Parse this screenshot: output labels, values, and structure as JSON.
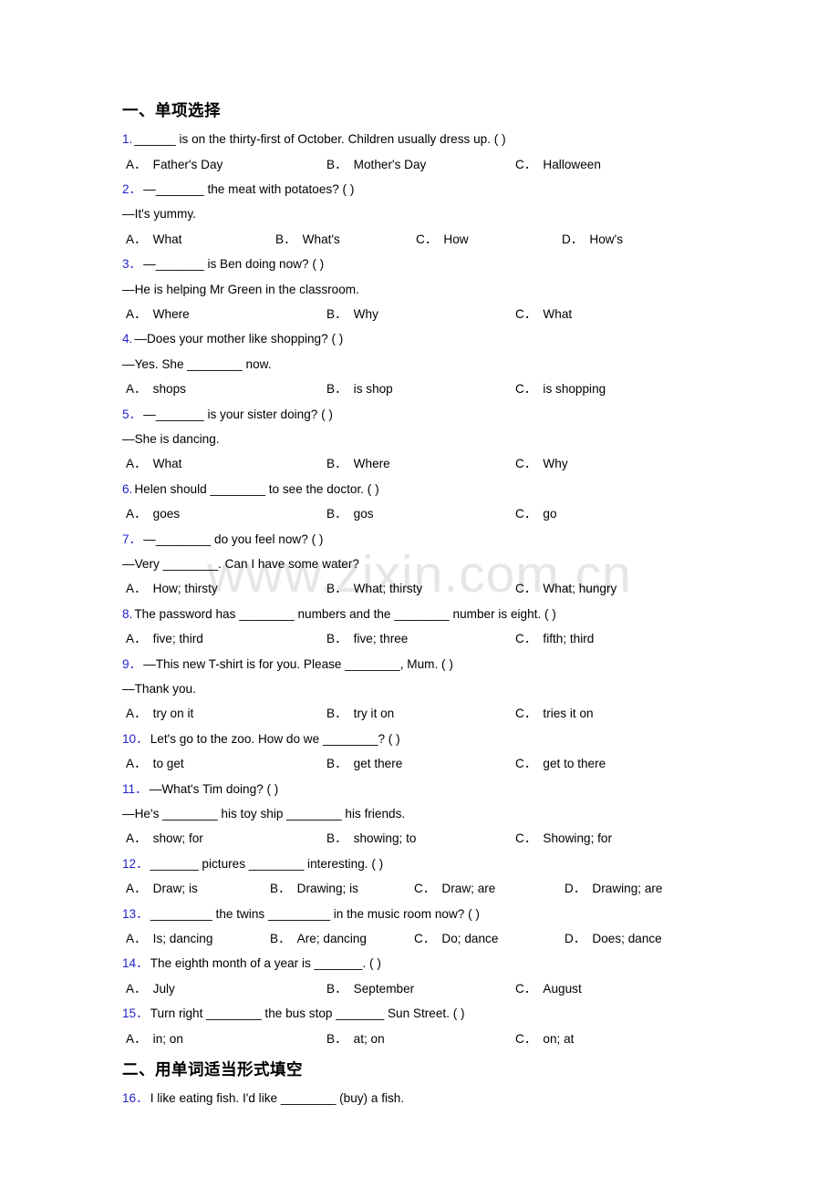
{
  "watermark": "www.zixin.com.cn",
  "colors": {
    "question_number": "#2222cc",
    "body_text": "#000000",
    "watermark": "#e6e6e6",
    "page_background": "#ffffff"
  },
  "sections": [
    {
      "id": "section-1",
      "heading": "一、单项选择"
    },
    {
      "id": "section-2",
      "heading": "二、用单词适当形式填空"
    }
  ],
  "questions": [
    {
      "num": "1.",
      "stem": "______ is on the thirty-first of October. Children usually dress up. (   )",
      "cont": null,
      "layout": "cols3",
      "options": [
        {
          "label": "A．",
          "text": "Father's Day"
        },
        {
          "label": "B．",
          "text": "Mother's Day"
        },
        {
          "label": "C．",
          "text": "Halloween"
        }
      ]
    },
    {
      "num": "2．",
      "stem": "—_______ the meat with potatoes? (   )",
      "cont": "—It's yummy.",
      "layout": "cols4",
      "options": [
        {
          "label": "A．",
          "text": "What"
        },
        {
          "label": "B．",
          "text": "What's"
        },
        {
          "label": "C．",
          "text": "How"
        },
        {
          "label": "D．",
          "text": "How's"
        }
      ]
    },
    {
      "num": "3．",
      "stem": "—_______ is Ben doing now? (  )",
      "cont": "—He is helping Mr Green in the classroom.",
      "layout": "cols3",
      "options": [
        {
          "label": "A．",
          "text": "Where"
        },
        {
          "label": "B．",
          "text": "Why"
        },
        {
          "label": "C．",
          "text": "What"
        }
      ]
    },
    {
      "num": "4.",
      "stem": "—Does your mother like shopping? (    )",
      "cont": "—Yes. She ________ now.",
      "layout": "cols3",
      "options": [
        {
          "label": "A．",
          "text": "shops"
        },
        {
          "label": "B．",
          "text": "is shop"
        },
        {
          "label": "C．",
          "text": "is shopping"
        }
      ]
    },
    {
      "num": "5．",
      "stem": "—_______ is your sister doing? (   )",
      "cont": "—She is dancing.",
      "layout": "cols3",
      "options": [
        {
          "label": "A．",
          "text": "What"
        },
        {
          "label": "B．",
          "text": "Where"
        },
        {
          "label": "C．",
          "text": "Why"
        }
      ]
    },
    {
      "num": "6.",
      "stem": "Helen should ________ to see the doctor. (   )",
      "cont": null,
      "layout": "cols3",
      "options": [
        {
          "label": "A．",
          "text": "goes"
        },
        {
          "label": "B．",
          "text": "gos"
        },
        {
          "label": "C．",
          "text": "go"
        }
      ]
    },
    {
      "num": "7．",
      "stem": "—________ do you feel now? (   )",
      "cont": "—Very ________. Can I have some water?",
      "layout": "cols3",
      "options": [
        {
          "label": "A．",
          "text": "How; thirsty"
        },
        {
          "label": "B．",
          "text": "What; thirsty"
        },
        {
          "label": "C．",
          "text": "What; hungry"
        }
      ]
    },
    {
      "num": "8.",
      "stem": "The password has ________ numbers and the ________ number is eight. (   )",
      "cont": null,
      "layout": "cols3",
      "options": [
        {
          "label": "A．",
          "text": "five; third"
        },
        {
          "label": "B．",
          "text": "five; three"
        },
        {
          "label": "C．",
          "text": "fifth; third"
        }
      ]
    },
    {
      "num": "9．",
      "stem": "—This new T-shirt is for you. Please ________, Mum. (    )",
      "cont": "—Thank you.",
      "layout": "cols3",
      "options": [
        {
          "label": "A．",
          "text": "try on it"
        },
        {
          "label": "B．",
          "text": "try it on"
        },
        {
          "label": "C．",
          "text": "tries it on"
        }
      ]
    },
    {
      "num": "10．",
      "stem": "Let's go to the zoo. How do we ________? (    )",
      "cont": null,
      "layout": "cols3",
      "options": [
        {
          "label": "A．",
          "text": "to get"
        },
        {
          "label": "B．",
          "text": "get there"
        },
        {
          "label": "C．",
          "text": "get to there"
        }
      ]
    },
    {
      "num": "11．",
      "stem": "—What's Tim doing? (  )",
      "cont": "—He's ________ his toy ship ________ his friends.",
      "layout": "cols3",
      "options": [
        {
          "label": "A．",
          "text": "show; for"
        },
        {
          "label": "B．",
          "text": "showing; to"
        },
        {
          "label": "C．",
          "text": "Showing; for"
        }
      ]
    },
    {
      "num": "12．",
      "stem": "_______ pictures ________ interesting. (  )",
      "cont": null,
      "layout": "cols4b",
      "options": [
        {
          "label": "A．",
          "text": "Draw; is"
        },
        {
          "label": "B．",
          "text": "Drawing; is"
        },
        {
          "label": "C．",
          "text": "Draw; are"
        },
        {
          "label": "D．",
          "text": "Drawing; are"
        }
      ]
    },
    {
      "num": "13．",
      "stem": "_________ the twins _________ in the music room now? (  )",
      "cont": null,
      "layout": "cols4b",
      "options": [
        {
          "label": "A．",
          "text": "Is; dancing"
        },
        {
          "label": "B．",
          "text": "Are; dancing"
        },
        {
          "label": "C．",
          "text": "Do; dance"
        },
        {
          "label": "D．",
          "text": "Does; dance"
        }
      ]
    },
    {
      "num": "14．",
      "stem": "The eighth month of a year is _______. (  )",
      "cont": null,
      "layout": "cols3",
      "options": [
        {
          "label": "A．",
          "text": "July"
        },
        {
          "label": "B．",
          "text": "September"
        },
        {
          "label": "C．",
          "text": "August"
        }
      ]
    },
    {
      "num": "15．",
      "stem": "Turn right ________ the bus stop _______ Sun Street. (  )",
      "cont": null,
      "layout": "cols3",
      "options": [
        {
          "label": "A．",
          "text": "in; on"
        },
        {
          "label": "B．",
          "text": "at; on"
        },
        {
          "label": "C．",
          "text": "on; at"
        }
      ]
    },
    {
      "num": "16．",
      "stem": "I like eating fish. I'd like ________ (buy) a fish.",
      "cont": null,
      "layout": null,
      "options": []
    }
  ]
}
